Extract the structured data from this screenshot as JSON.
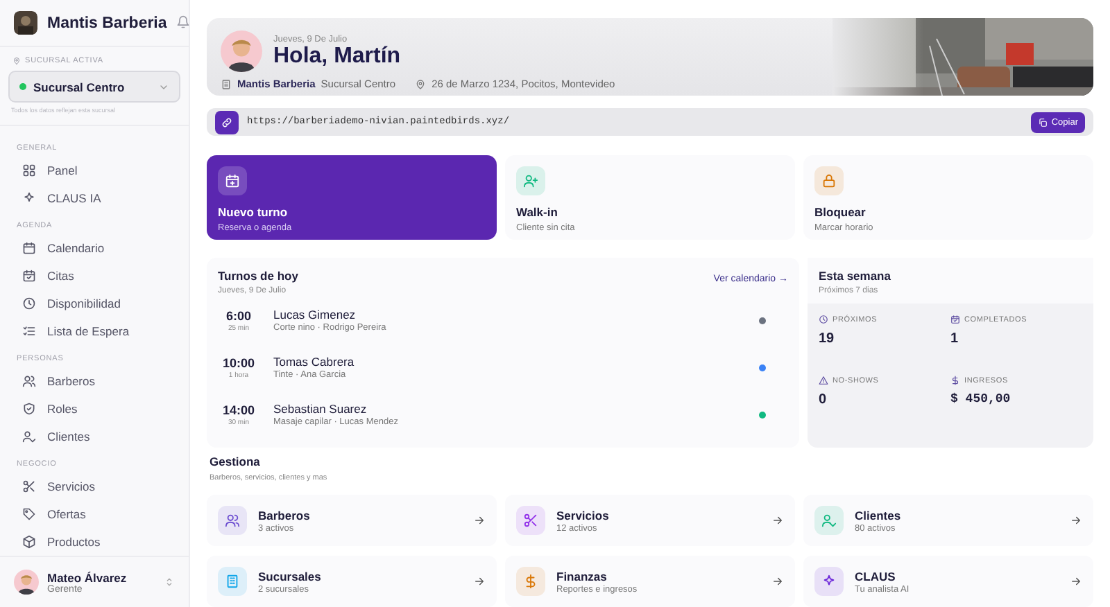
{
  "sidebar": {
    "brand": "Mantis Barberia",
    "branch": {
      "label": "SUCURSAL ACTIVA",
      "value": "Sucursal Centro",
      "hint": "Todos los datos reflejan esta sucursal",
      "color": "#22c55e"
    },
    "sections": [
      {
        "title": "GENERAL",
        "items": [
          {
            "label": "Panel",
            "selected": false
          },
          {
            "label": "CLAUS IA",
            "selected": false
          }
        ]
      },
      {
        "title": "AGENDA",
        "items": [
          {
            "label": "Calendario",
            "selected": false
          },
          {
            "label": "Citas",
            "selected": false
          },
          {
            "label": "Disponibilidad",
            "selected": false
          },
          {
            "label": "Lista de Espera",
            "selected": false
          }
        ]
      },
      {
        "title": "PERSONAS",
        "items": [
          {
            "label": "Barberos",
            "selected": false
          },
          {
            "label": "Roles",
            "selected": false
          },
          {
            "label": "Clientes",
            "selected": false
          }
        ]
      },
      {
        "title": "NEGOCIO",
        "items": [
          {
            "label": "Servicios",
            "selected": false
          },
          {
            "label": "Ofertas",
            "selected": false
          },
          {
            "label": "Productos",
            "selected": false
          }
        ]
      }
    ],
    "user": {
      "name": "Mateo Álvarez",
      "role": "Gerente"
    }
  },
  "header": {
    "date": "Jueves, 9 De Julio",
    "greeting": "Hola, Martín",
    "business": "Mantis Barberia",
    "branch": "Sucursal Centro",
    "address": "26 de Marzo 1234, Pocitos, Montevideo"
  },
  "link": {
    "url": "https://barberiademo-nivian.paintedbirds.xyz/",
    "button": "Copiar"
  },
  "actions": [
    {
      "title": "Nuevo turno",
      "subtitle": "Reserva o agenda",
      "kind": "primary",
      "color": "#ffffff"
    },
    {
      "title": "Walk-in",
      "subtitle": "Cliente sin cita",
      "kind": "plain",
      "color": "#10b981"
    },
    {
      "title": "Bloquear",
      "subtitle": "Marcar horario",
      "kind": "plain",
      "color": "#d97706"
    }
  ],
  "today": {
    "title": "Turnos de hoy",
    "date": "Jueves, 9 De Julio",
    "link": "Ver calendario →",
    "appointments": [
      {
        "time": "6:00",
        "duration": "25 min",
        "client": "Lucas Gimenez",
        "detail": "Corte nino · Rodrigo Pereira",
        "color": "#6b7280"
      },
      {
        "time": "10:00",
        "duration": "1 hora",
        "client": "Tomas Cabrera",
        "detail": "Tinte · Ana Garcia",
        "color": "#3b82f6"
      },
      {
        "time": "14:00",
        "duration": "30 min",
        "client": "Sebastian Suarez",
        "detail": "Masaje capilar · Lucas Mendez",
        "color": "#10b981"
      }
    ]
  },
  "week": {
    "title": "Esta semana",
    "subtitle": "Próximos 7 dias",
    "metrics": [
      {
        "label": "PRÓXIMOS",
        "value": "19"
      },
      {
        "label": "COMPLETADOS",
        "value": "1"
      },
      {
        "label": "NO-SHOWS",
        "value": "0"
      },
      {
        "label": "INGRESOS",
        "value": "$ 450,00"
      }
    ]
  },
  "manage": {
    "title": "Gestiona",
    "subtitle": "Barberos, servicios, clientes y mas",
    "items": [
      {
        "title": "Barberos",
        "subtitle": "3 activos",
        "color": "#6d4fd1"
      },
      {
        "title": "Servicios",
        "subtitle": "12 activos",
        "color": "#9333ea"
      },
      {
        "title": "Clientes",
        "subtitle": "80 activos",
        "color": "#10b981"
      },
      {
        "title": "Sucursales",
        "subtitle": "2 sucursales",
        "color": "#0ea5e9"
      },
      {
        "title": "Finanzas",
        "subtitle": "Reportes e ingresos",
        "color": "#d97706"
      },
      {
        "title": "CLAUS",
        "subtitle": "Tu analista AI",
        "color": "#6d28d9"
      }
    ]
  }
}
